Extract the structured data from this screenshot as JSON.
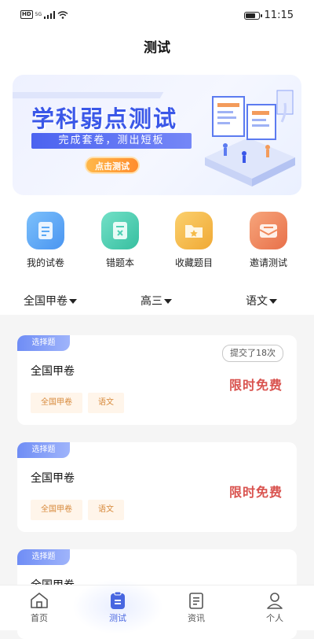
{
  "status_bar": {
    "network": "HD",
    "signal": "5G",
    "time": "11:15",
    "battery_level": 0.8
  },
  "header": {
    "title": "测试"
  },
  "banner": {
    "headline": "学科弱点测试",
    "subtitle": "完成套卷，测出短板",
    "button": "点击测试"
  },
  "quick_actions": [
    {
      "label": "我的试卷",
      "icon": "document-icon",
      "color": "#5aa8f6"
    },
    {
      "label": "错题本",
      "icon": "wrong-questions-icon",
      "color": "#4fd0b4"
    },
    {
      "label": "收藏题目",
      "icon": "folder-star-icon",
      "color": "#f5bb48"
    },
    {
      "label": "邀请测试",
      "icon": "invite-mail-icon",
      "color": "#f08a5d"
    }
  ],
  "filters": [
    {
      "label": "全国甲卷"
    },
    {
      "label": "高三"
    },
    {
      "label": "语文"
    }
  ],
  "cards": [
    {
      "tag": "选择题",
      "name": "全国甲卷",
      "status": "提交了18次",
      "price": "限时免费",
      "chips": [
        "全国甲卷",
        "语文"
      ]
    },
    {
      "tag": "选择题",
      "name": "全国甲卷",
      "price": "限时免费",
      "chips": [
        "全国甲卷",
        "语文"
      ]
    },
    {
      "tag": "选择题",
      "name": "全国甲卷"
    }
  ],
  "bottom_nav": [
    {
      "label": "首页",
      "icon": "home-icon"
    },
    {
      "label": "测试",
      "icon": "test-icon",
      "active": true
    },
    {
      "label": "资讯",
      "icon": "news-icon"
    },
    {
      "label": "个人",
      "icon": "person-icon"
    }
  ],
  "colors": {
    "accent": "#4866e0",
    "price": "#d9534f",
    "chip_text": "#d78a3c"
  }
}
